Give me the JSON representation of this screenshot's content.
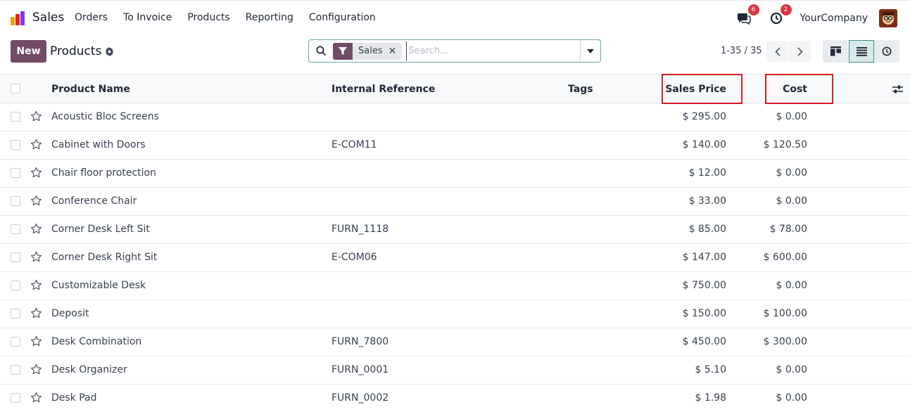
{
  "navbar": {
    "app_name": "Sales",
    "menu": [
      "Orders",
      "To Invoice",
      "Products",
      "Reporting",
      "Configuration"
    ],
    "messages_count": "6",
    "activities_count": "2",
    "company": "YourCompany"
  },
  "control_panel": {
    "new_label": "New",
    "breadcrumb": "Products",
    "facet_label": "Sales",
    "search_placeholder": "Search...",
    "pager": "1-35 / 35"
  },
  "table": {
    "columns": {
      "name": "Product Name",
      "ref": "Internal Reference",
      "tags": "Tags",
      "price": "Sales Price",
      "cost": "Cost"
    },
    "rows": [
      {
        "name": "Acoustic Bloc Screens",
        "ref": "",
        "price": "$ 295.00",
        "cost": "$ 0.00"
      },
      {
        "name": "Cabinet with Doors",
        "ref": "E-COM11",
        "price": "$ 140.00",
        "cost": "$ 120.50"
      },
      {
        "name": "Chair floor protection",
        "ref": "",
        "price": "$ 12.00",
        "cost": "$ 0.00"
      },
      {
        "name": "Conference Chair",
        "ref": "",
        "price": "$ 33.00",
        "cost": "$ 0.00"
      },
      {
        "name": "Corner Desk Left Sit",
        "ref": "FURN_1118",
        "price": "$ 85.00",
        "cost": "$ 78.00"
      },
      {
        "name": "Corner Desk Right Sit",
        "ref": "E-COM06",
        "price": "$ 147.00",
        "cost": "$ 600.00"
      },
      {
        "name": "Customizable Desk",
        "ref": "",
        "price": "$ 750.00",
        "cost": "$ 0.00"
      },
      {
        "name": "Deposit",
        "ref": "",
        "price": "$ 150.00",
        "cost": "$ 100.00"
      },
      {
        "name": "Desk Combination",
        "ref": "FURN_7800",
        "price": "$ 450.00",
        "cost": "$ 300.00"
      },
      {
        "name": "Desk Organizer",
        "ref": "FURN_0001",
        "price": "$ 5.10",
        "cost": "$ 0.00"
      },
      {
        "name": "Desk Pad",
        "ref": "FURN_0002",
        "price": "$ 1.98",
        "cost": "$ 0.00"
      }
    ]
  },
  "icons": {
    "app_logo": "sales-app-icon",
    "messages": "chat-icon",
    "activities": "clock-icon",
    "settings": "gear-icon",
    "search": "search-icon",
    "filter": "filter-icon",
    "kanban": "kanban-view-icon",
    "list": "list-view-icon",
    "activity_view": "activity-view-icon",
    "favorite": "star-icon",
    "optional_columns": "sliders-icon"
  },
  "colors": {
    "brand": "#714b67",
    "highlight": "#d32026",
    "badge": "#dc3545"
  }
}
